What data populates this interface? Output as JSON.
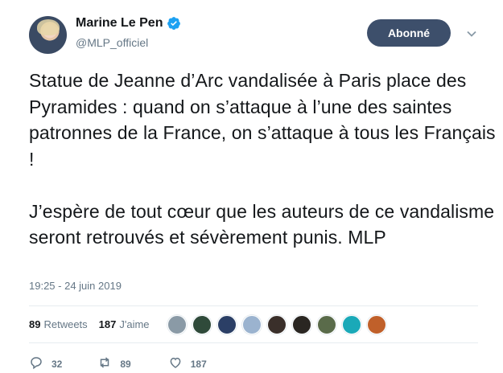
{
  "header": {
    "display_name": "Marine Le Pen",
    "handle": "@MLP_officiel",
    "follow_button_label": "Abonné",
    "icons": {
      "verified": "verified-badge-icon",
      "more": "chevron-down-icon"
    }
  },
  "tweet": {
    "text": "Statue de Jeanne d’Arc vandalisée à Paris place des Pyramides : quand on s’attaque à l’une des saintes patronnes de la France, on s’attaque à tous les Français !\n\nJ’espère de tout cœur que les auteurs de ce vandalisme seront retrouvés et sévèrement punis. MLP",
    "timestamp": "19:25 - 24 juin 2019"
  },
  "stats": {
    "retweets_count": "89",
    "retweets_label": "Retweets",
    "likes_count": "187",
    "likes_label": "J'aime",
    "liker_avatars": [
      "#8a9aa6",
      "#2f4a3a",
      "#2b3f66",
      "#9bb3cf",
      "#3a2f2a",
      "#2a2622",
      "#5a6b4a",
      "#1aa9b8",
      "#c0602a"
    ]
  },
  "actions": {
    "reply_count": "32",
    "retweet_count": "89",
    "like_count": "187"
  },
  "colors": {
    "accent": "#1da1f2",
    "follow_button": "#3d4f6b",
    "secondary_text": "#657786"
  }
}
